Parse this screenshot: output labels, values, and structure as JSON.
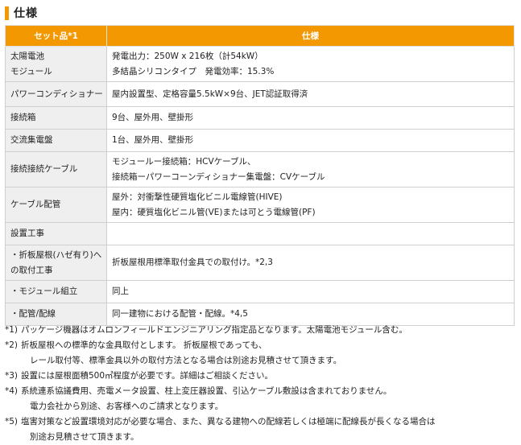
{
  "section": {
    "title": "仕様"
  },
  "table": {
    "headers": [
      "セット品*1",
      "仕様"
    ],
    "rows": [
      {
        "label": [
          "太陽電池",
          "モジュール"
        ],
        "value": [
          "発電出力：250W x 216枚（計54kW）",
          "多結晶シリコンタイプ　発電効率：15.3%"
        ]
      },
      {
        "label": [
          "パワーコンディショナー"
        ],
        "value": [
          "屋内設置型、定格容量5.5kW×9台、JET認証取得済"
        ]
      },
      {
        "label": [
          "接続箱"
        ],
        "value": [
          "9台、屋外用、壁掛形"
        ]
      },
      {
        "label": [
          "交流集電盤"
        ],
        "value": [
          "1台、屋外用、壁掛形"
        ]
      },
      {
        "label": [
          "接続接続ケーブル"
        ],
        "value": [
          "モジュールー接続箱：HCVケーブル、",
          "接続箱ーパワーコーンディショナー集電盤：CVケーブル"
        ]
      },
      {
        "label": [
          "ケーブル配管"
        ],
        "value": [
          "屋外：対衝撃性硬質塩化ビニル電線管(HIVE)",
          "屋内：硬質塩化ビニル管(VE)または可とう電線管(PF)"
        ]
      },
      {
        "label": [
          "設置工事"
        ],
        "value": [
          ""
        ]
      },
      {
        "label": [
          "・折板屋根(ハゼ有り)へ",
          "の取付工事"
        ],
        "value": [
          "折板屋根用標準取付金具での取付け。*2,3"
        ]
      },
      {
        "label": [
          "・モジュール組立"
        ],
        "value": [
          "同上"
        ]
      },
      {
        "label": [
          "・配管/配線"
        ],
        "value": [
          "同一建物における配管・配線。*4,5"
        ]
      }
    ]
  },
  "notes": [
    {
      "mark": "*1)",
      "lines": [
        "パッケージ機器はオムロンフィールドエンジニアリング指定品となります。太陽電池モジュール含む。"
      ]
    },
    {
      "mark": "*2)",
      "lines": [
        "折板屋根への標準的な金具取付とします。 折板屋根であっても、",
        "レール取付等、標準金具以外の取付方法となる場合は別途お見積させて頂きます。"
      ]
    },
    {
      "mark": "*3)",
      "lines": [
        "設置には屋根面積500㎡程度が必要です。詳細はご相談ください。"
      ]
    },
    {
      "mark": "*4)",
      "lines": [
        "系統連系協議費用、売電メータ設置、柱上変圧器設置、引込ケーブル敷設は含まれておりません。",
        "電力会社から別途、お客様へのご請求となります。"
      ]
    },
    {
      "mark": "*5)",
      "lines": [
        "塩害対策など設置環境対応が必要な場合、また、異なる建物への配線若しくは極端に配線長が長くなる場合は",
        "別途お見積させて頂きます。"
      ]
    }
  ],
  "colors": {
    "accent": "#f39800",
    "label_bg": "#efefef",
    "border": "#cfcfcf"
  }
}
